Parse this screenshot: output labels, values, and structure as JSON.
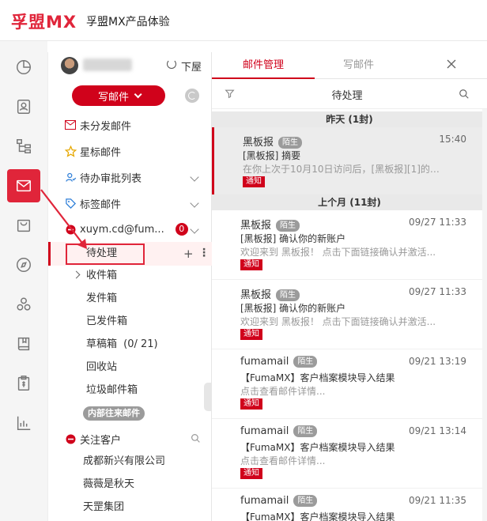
{
  "app": {
    "logo": "孚盟MX",
    "title": "孚盟MX产品体验"
  },
  "rail": {
    "items": [
      {
        "name": "dashboard-icon"
      },
      {
        "name": "contacts-icon"
      },
      {
        "name": "org-tree-icon"
      },
      {
        "name": "mail-icon",
        "active": true
      },
      {
        "name": "shop-bag-icon"
      },
      {
        "name": "compass-icon"
      },
      {
        "name": "cluster-icon"
      },
      {
        "name": "book-icon"
      },
      {
        "name": "finance-icon"
      },
      {
        "name": "chart-icon"
      }
    ]
  },
  "account": {
    "down_label": "下屋"
  },
  "compose": {
    "label": "写邮件"
  },
  "folders": {
    "undistributed": "未分发邮件",
    "starred": "星标邮件",
    "approval": "待办审批列表",
    "tagged": "标签邮件",
    "mailbox": "xuym.cd@fum...",
    "mailbox_badge": "0",
    "pending": "待处理",
    "inbox": "收件箱",
    "outbox": "发件箱",
    "sent": "已发件箱",
    "drafts": "草稿箱",
    "drafts_count": "(0/ 21)",
    "recycle": "回收站",
    "spam": "垃圾邮件箱",
    "internal": "内部往来邮件",
    "watched": "关注客户",
    "customers": [
      "成都新兴有限公司",
      "薇薇是秋天",
      "天罡集团"
    ]
  },
  "tabs": {
    "manage": "邮件管理",
    "compose": "写邮件"
  },
  "list": {
    "title": "待处理",
    "groups": {
      "yesterday": "昨天 (1封)",
      "last_month": "上个月 (11封)"
    },
    "items": [
      {
        "sender": "黑板报",
        "tag": "陌生",
        "time": "15:40",
        "subject": "[黑板报] 摘要",
        "preview": "在你上次于10月10日访问后，[黑板报][1]的新...",
        "notice": "通知"
      },
      {
        "sender": "黑板报",
        "tag": "陌生",
        "time": "09/27 11:33",
        "subject": "[黑板报] 确认你的新账户",
        "preview": "欢迎来到 黑板报！ 点击下面链接确认并激活...",
        "notice": "通知"
      },
      {
        "sender": "黑板报",
        "tag": "陌生",
        "time": "09/27 11:33",
        "subject": "[黑板报] 确认你的新账户",
        "preview": "欢迎来到 黑板报！ 点击下面链接确认并激活...",
        "notice": "通知"
      },
      {
        "sender": "fumamail",
        "tag": "陌生",
        "time": "09/21 13:19",
        "subject": "【FumaMX】客户档案模块导入结果",
        "preview": "点击查看邮件详情...",
        "notice": "通知"
      },
      {
        "sender": "fumamail",
        "tag": "陌生",
        "time": "09/21 13:14",
        "subject": "【FumaMX】客户档案模块导入结果",
        "preview": "点击查看邮件详情...",
        "notice": "通知"
      },
      {
        "sender": "fumamail",
        "tag": "陌生",
        "time": "09/21 11:35",
        "subject": "【FumaMX】客户档案模块导入结果",
        "preview": "",
        "notice": ""
      }
    ]
  },
  "colors": {
    "brand": "#d0021b",
    "annotation": "#e0253a"
  }
}
